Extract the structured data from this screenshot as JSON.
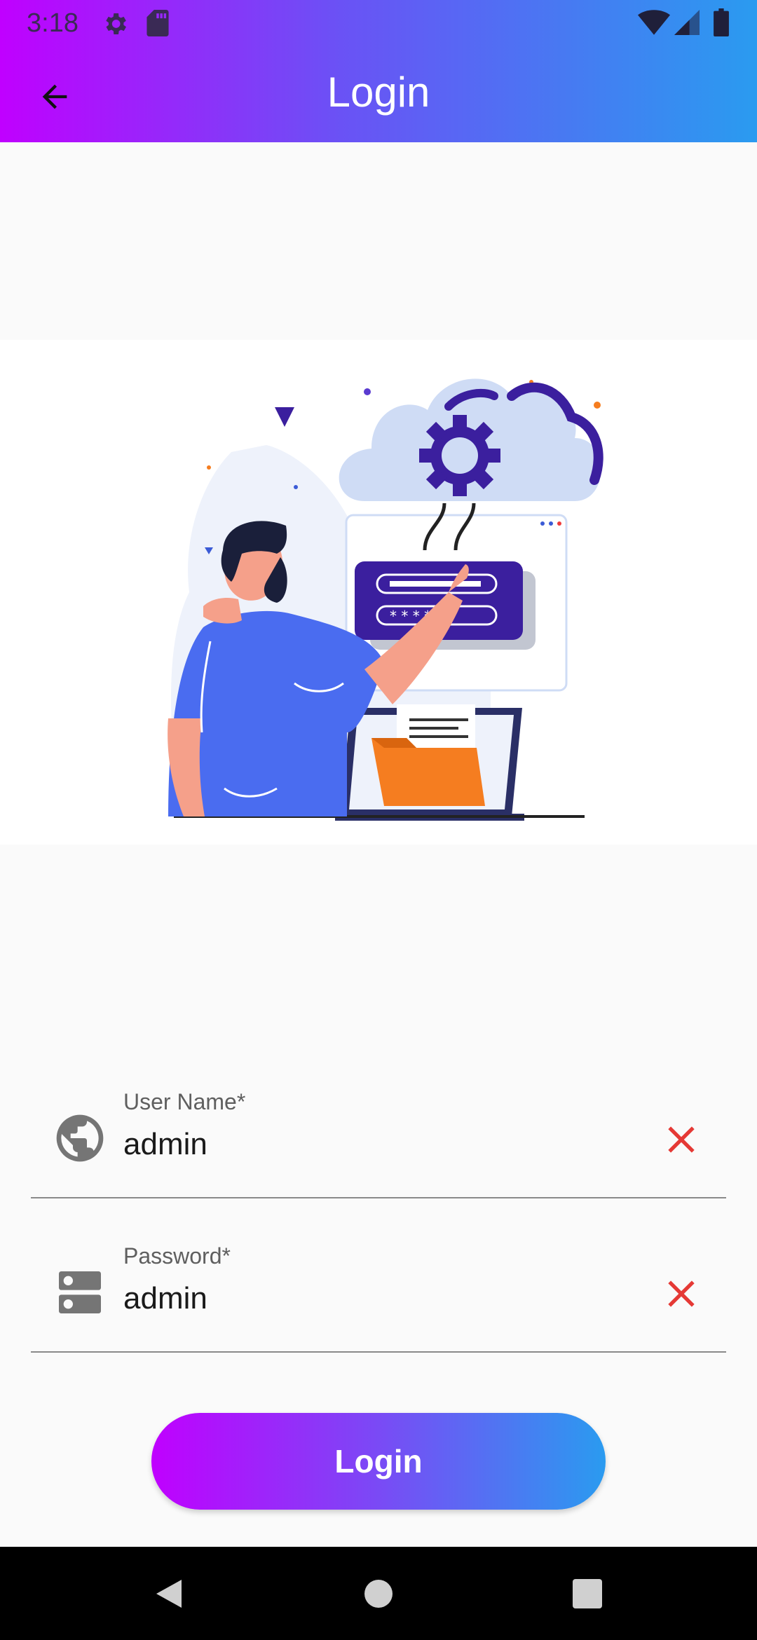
{
  "status_bar": {
    "time": "3:18",
    "icons": [
      "settings-icon",
      "sd-card-icon",
      "wifi-icon",
      "signal-icon",
      "battery-icon"
    ]
  },
  "app_bar": {
    "title": "Login",
    "back_icon": "arrow-back-icon",
    "gradient": [
      "#c000ff",
      "#6a52f5",
      "#2a9bf0"
    ]
  },
  "illustration": {
    "name": "cloud-login-illustration"
  },
  "form": {
    "username": {
      "label": "User Name*",
      "value": "admin",
      "icon": "globe-icon",
      "clear_icon": "close-icon"
    },
    "password": {
      "label": "Password*",
      "value": "admin",
      "icon": "server-icon",
      "clear_icon": "close-icon"
    },
    "clear_color": "#e53935"
  },
  "login_button": {
    "label": "Login"
  },
  "nav_bar": {
    "icons": [
      "nav-back-icon",
      "nav-home-icon",
      "nav-recents-icon"
    ]
  }
}
